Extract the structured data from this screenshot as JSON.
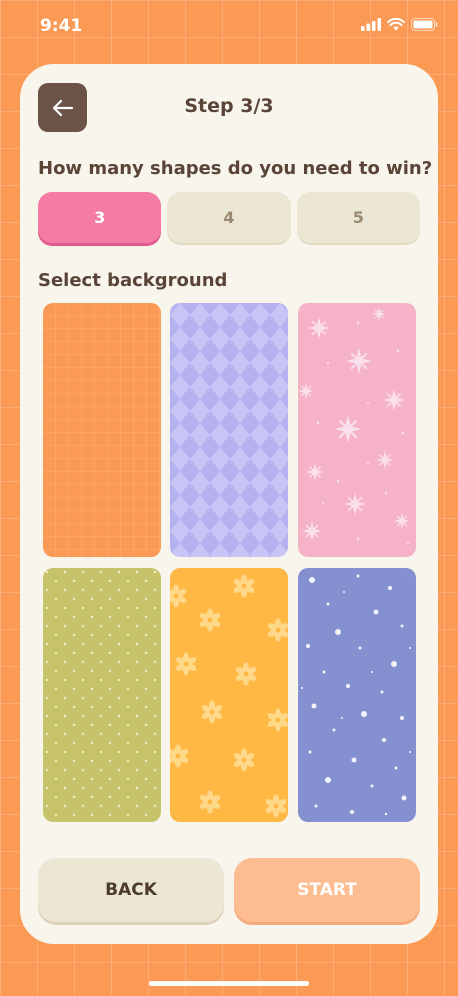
{
  "status": {
    "time": "9:41"
  },
  "header": {
    "title": "Step 3/3"
  },
  "question": "How many shapes do you need to win?",
  "options": [
    {
      "label": "3",
      "selected": true
    },
    {
      "label": "4",
      "selected": false
    },
    {
      "label": "5",
      "selected": false
    }
  ],
  "background_section": {
    "label": "Select background"
  },
  "backgrounds": [
    {
      "pattern": "grid",
      "color": "#fb9a55"
    },
    {
      "pattern": "diamonds",
      "color": "#b9b5f2"
    },
    {
      "pattern": "sparkles",
      "color": "#f6b3c8"
    },
    {
      "pattern": "dots",
      "color": "#c6c36a"
    },
    {
      "pattern": "flowers",
      "color": "#ffb844"
    },
    {
      "pattern": "splatter",
      "color": "#8490cf"
    }
  ],
  "footer": {
    "back_label": "BACK",
    "start_label": "START"
  },
  "colors": {
    "accent": "#f47ba3",
    "brand_brown": "#5a4438",
    "background": "#fb9a55"
  }
}
